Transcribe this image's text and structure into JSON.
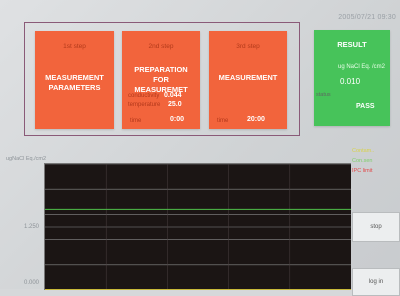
{
  "header": {
    "timestamp": "2005/07/21 09:30"
  },
  "steps": [
    {
      "step_no": "1st step",
      "title_line1": "MEASUREMENT",
      "title_line2": "PARAMETERS"
    },
    {
      "step_no": "2nd step",
      "title_line1": "PREPARATION FOR",
      "title_line2": "MEASUREMET",
      "conductivity_label": "conductivity",
      "conductivity_value": "0.044",
      "temperature_label": "temperature",
      "temperature_value": "25.0",
      "time_label": "time",
      "time_value": "0:00"
    },
    {
      "step_no": "3rd step",
      "title": "MEASUREMENT",
      "time_label": "time",
      "time_value": "20:00"
    }
  ],
  "result": {
    "title": "RESULT",
    "unit": "ug NaCl Eq. /cm2",
    "value": "0.010",
    "status_label": "status",
    "status_value": "PASS"
  },
  "legend": [
    {
      "label": "Contam..",
      "color": "#d8d24a"
    },
    {
      "label": "Con.sen",
      "color": "#7fcf6a"
    },
    {
      "label": "IPC limit",
      "color": "#e24a4a"
    }
  ],
  "buttons": {
    "stop_label": "stop",
    "login_label": "log in"
  },
  "chart_data": {
    "type": "line",
    "ylabel": "ugNaCl Eq./cm2",
    "yticks": [
      "1.250",
      "0.000"
    ],
    "ylim": [
      0,
      2.5
    ],
    "grid": true,
    "series": [
      {
        "values": [
          [
            0,
            1.6
          ],
          [
            1,
            1.6
          ]
        ],
        "color": "#4fbf4a"
      },
      {
        "values": [
          [
            0,
            0.0
          ],
          [
            1,
            0.0
          ]
        ],
        "color": "#c9b93a"
      }
    ],
    "grid_levels": [
      2.5,
      2.0,
      1.5,
      1.25,
      1.0,
      0.5
    ],
    "vgrid_fractions": [
      0.2,
      0.4,
      0.6,
      0.8
    ]
  }
}
